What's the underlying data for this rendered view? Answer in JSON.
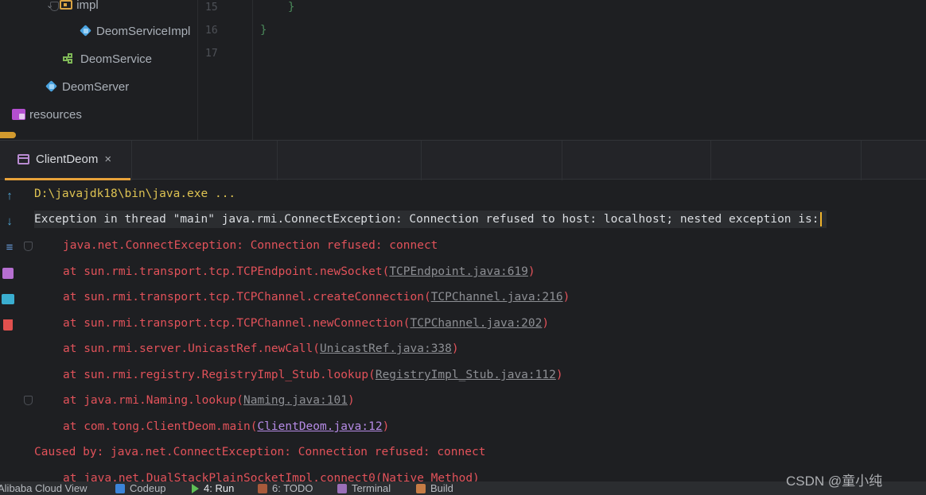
{
  "project_tree": {
    "items": [
      {
        "label": "impl",
        "kind": "folder"
      },
      {
        "label": "DeomServiceImpl",
        "kind": "class"
      },
      {
        "label": "DeomService",
        "kind": "interface"
      },
      {
        "label": "DeomServer",
        "kind": "class"
      },
      {
        "label": "resources",
        "kind": "resources-folder"
      }
    ]
  },
  "editor": {
    "line_numbers": [
      "15",
      "16",
      "17"
    ],
    "code_lines": [
      "}",
      "}"
    ]
  },
  "run_tab": {
    "label": "ClientDeom",
    "close": "×"
  },
  "console": {
    "command": "D:\\javajdk18\\bin\\java.exe ...",
    "exception": "Exception in thread \"main\" java.rmi.ConnectException: Connection refused to host: localhost; nested exception is:",
    "nested": "java.net.ConnectException: Connection refused: connect",
    "frames": [
      {
        "at": "at sun.rmi.transport.tcp.TCPEndpoint.newSocket(",
        "link": "TCPEndpoint.java:619",
        "end": ")"
      },
      {
        "at": "at sun.rmi.transport.tcp.TCPChannel.createConnection(",
        "link": "TCPChannel.java:216",
        "end": ")"
      },
      {
        "at": "at sun.rmi.transport.tcp.TCPChannel.newConnection(",
        "link": "TCPChannel.java:202",
        "end": ")"
      },
      {
        "at": "at sun.rmi.server.UnicastRef.newCall(",
        "link": "UnicastRef.java:338",
        "end": ")"
      },
      {
        "at": "at sun.rmi.registry.RegistryImpl_Stub.lookup(",
        "link": "RegistryImpl_Stub.java:112",
        "end": ")"
      },
      {
        "at": "at java.rmi.Naming.lookup(",
        "link": "Naming.java:101",
        "end": ")"
      },
      {
        "at": "at com.tong.ClientDeom.main(",
        "link": "ClientDeom.java:12",
        "end": ")"
      }
    ],
    "caused_by": "Caused by: java.net.ConnectException: Connection refused: connect",
    "partial_next": "at java.net.DualStackPlainSocketImpl.connect0(Native Method)"
  },
  "status_bar": {
    "items": [
      {
        "label": "Alibaba Cloud View",
        "icon": "none"
      },
      {
        "label": "Codeup",
        "icon": "codeup-icon"
      },
      {
        "label": "4: Run",
        "icon": "run-icon"
      },
      {
        "label": "6: TODO",
        "icon": "todo-icon"
      },
      {
        "label": "Terminal",
        "icon": "terminal-icon"
      },
      {
        "label": "Build",
        "icon": "build-icon"
      }
    ]
  },
  "watermark": "CSDN @童小纯",
  "colors": {
    "background": "#1e1f22",
    "error_red": "#e2525a",
    "command_yellow": "#ddc252",
    "tab_accent": "#e8a23a",
    "link_purple": "#b68be6"
  }
}
